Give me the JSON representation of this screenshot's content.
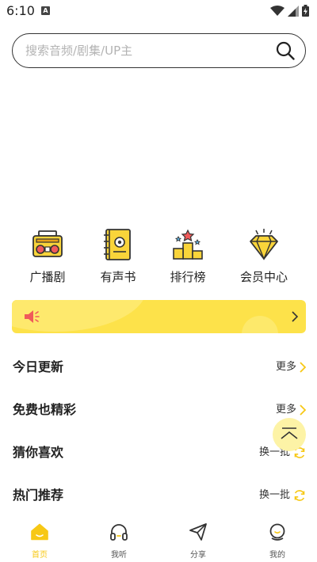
{
  "status_bar": {
    "time": "6:10",
    "notification_glyph": "A"
  },
  "search": {
    "placeholder": "搜索音频/剧集/UP主"
  },
  "categories": [
    {
      "label": "广播剧",
      "icon": "radio-icon"
    },
    {
      "label": "有声书",
      "icon": "audiobook-icon"
    },
    {
      "label": "排行榜",
      "icon": "podium-icon"
    },
    {
      "label": "会员中心",
      "icon": "diamond-icon"
    }
  ],
  "banner": {
    "icon": "speaker-icon",
    "accent": "#fde24a"
  },
  "sections": [
    {
      "title": "今日更新",
      "action": "更多",
      "action_icon": "chevron-right-icon"
    },
    {
      "title": "免费也精彩",
      "action": "更多",
      "action_icon": "chevron-right-icon"
    },
    {
      "title": "猜你喜欢",
      "action": "换一批",
      "action_icon": "refresh-icon"
    },
    {
      "title": "热门推荐",
      "action": "换一批",
      "action_icon": "refresh-icon"
    }
  ],
  "bottom_nav": [
    {
      "label": "首页",
      "icon": "home-icon",
      "active": true
    },
    {
      "label": "我听",
      "icon": "headphones-icon",
      "active": false
    },
    {
      "label": "分享",
      "icon": "paper-plane-icon",
      "active": false
    },
    {
      "label": "我的",
      "icon": "profile-icon",
      "active": false
    }
  ],
  "colors": {
    "accent": "#f7c815",
    "banner": "#fde24a",
    "text": "#222222"
  }
}
